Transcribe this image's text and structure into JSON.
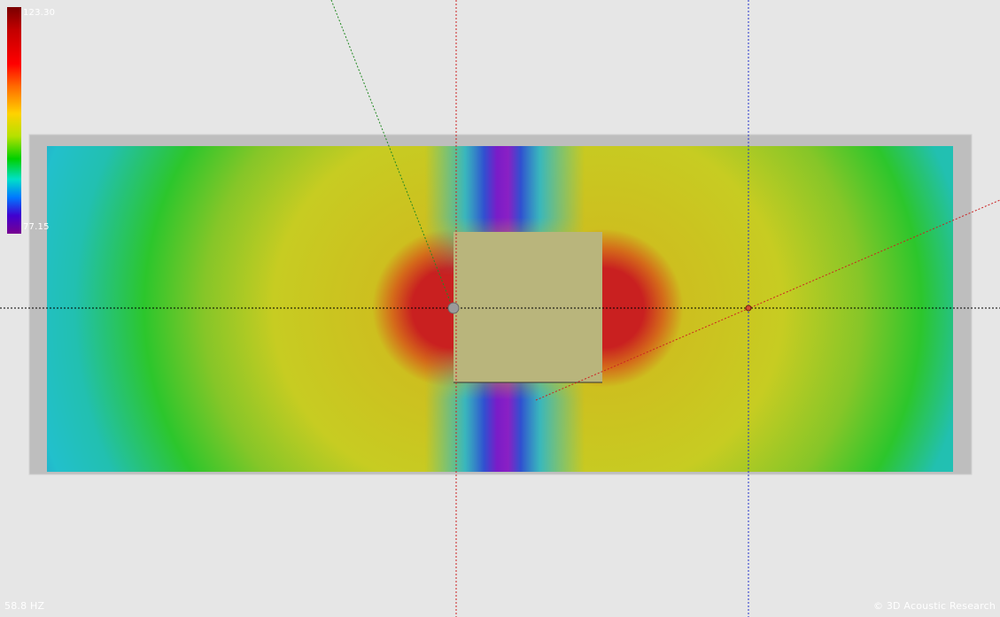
{
  "viewport": {
    "frequency": "58.8 HZ",
    "copyright": "© 3D Acoustic Research"
  },
  "colorbar": {
    "max": "123.30",
    "min": "77.15"
  },
  "colors": {
    "background": "#e6e6e6",
    "wall": "#bebebe",
    "obstacle": "#b9b57c",
    "axis_red": "#cc2222",
    "axis_blue": "#2233cc",
    "axis_green": "#228822",
    "axis_black": "#000000"
  }
}
